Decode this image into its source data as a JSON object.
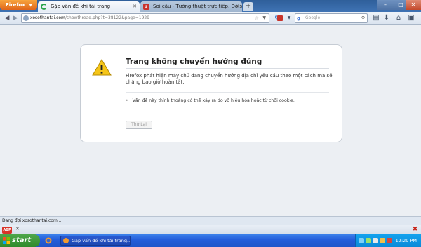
{
  "browser": {
    "menu_button": "Firefox",
    "tabs": [
      {
        "label": "Gặp vấn đề khi tải trang"
      },
      {
        "label": "Soi cầu - Tường thuật trực tiếp, Dò số, Tạo dàn, Thống kê"
      }
    ],
    "address": {
      "host": "xosothantai.com",
      "path": "/showthread.php?t=38122&page=1929"
    },
    "search_placeholder": "Google"
  },
  "error_page": {
    "title": "Trang không chuyển hướng đúng",
    "description": "Firefox phát hiện máy chủ đang chuyển hướng địa chỉ yêu cầu theo một cách mà sẽ chẳng bao giờ hoàn tất.",
    "bullets": [
      "Vấn đề này thỉnh thoảng có thể xảy ra do vô hiệu hóa hoặc từ chối cookie."
    ],
    "try_again_label": "Thử Lại"
  },
  "status_bar": {
    "text": "Đang đợi xosothantai.com..."
  },
  "taskbar": {
    "start_label": "start",
    "task_item": "Gặp vấn đề khi tải trang...",
    "clock": "12:29 PM"
  }
}
